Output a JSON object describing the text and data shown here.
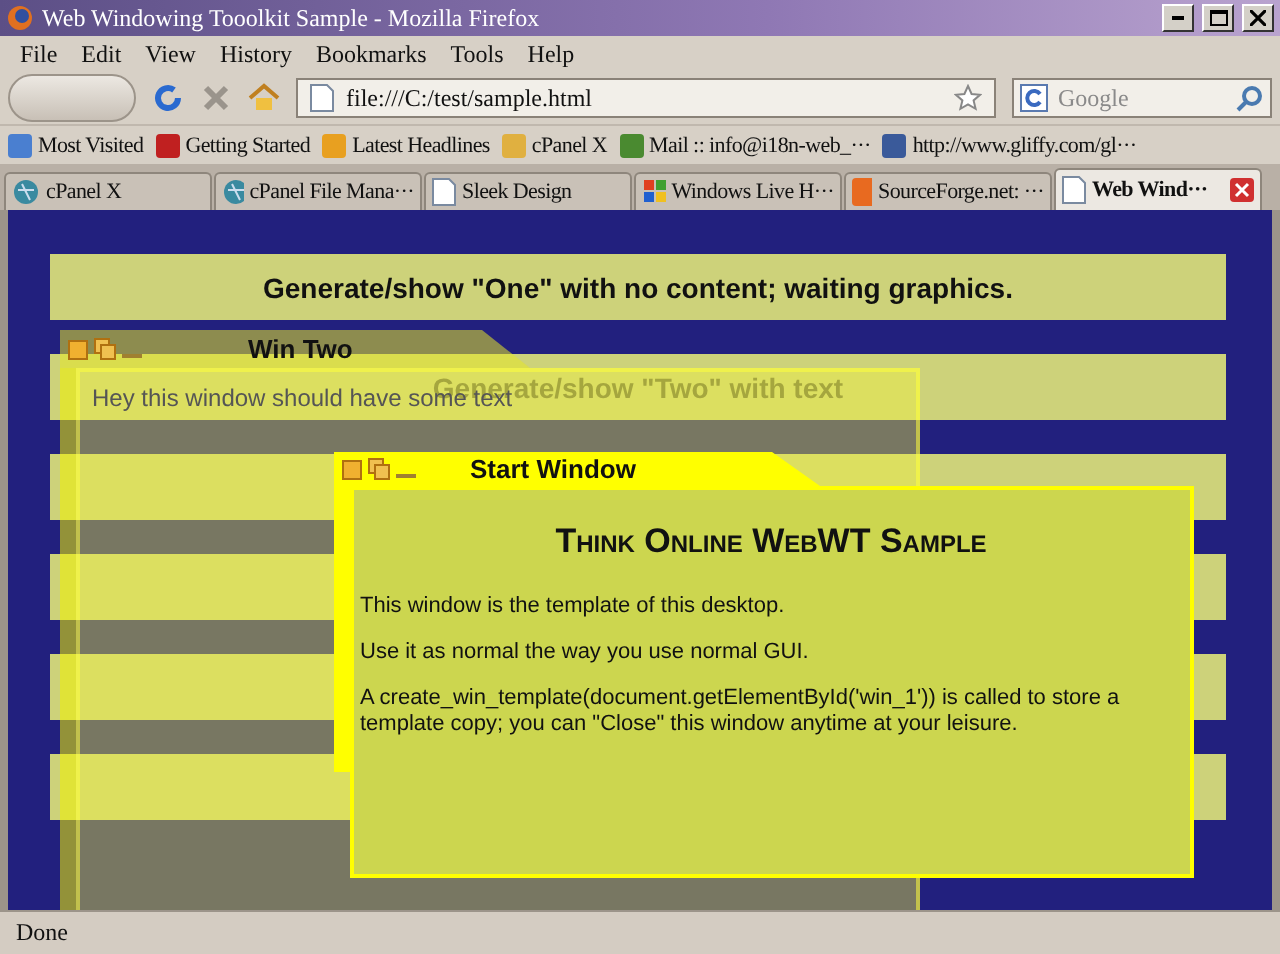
{
  "window": {
    "title": "Web Windowing Tooolkit Sample - Mozilla Firefox"
  },
  "menu": [
    "File",
    "Edit",
    "View",
    "History",
    "Bookmarks",
    "Tools",
    "Help"
  ],
  "address": {
    "value": "file:///C:/test/sample.html"
  },
  "search": {
    "placeholder": "Google"
  },
  "bookmarks": [
    {
      "label": "Most Visited",
      "color": "#4a7fd0"
    },
    {
      "label": "Getting Started",
      "color": "#c02020"
    },
    {
      "label": "Latest Headlines",
      "color": "#e8a020"
    },
    {
      "label": "cPanel X",
      "color": "#e0b040"
    },
    {
      "label": "Mail :: info@i18n-web_···",
      "color": "#4a8a30"
    },
    {
      "label": "http://www.gliffy.com/gl···",
      "color": "#3a5a9a"
    }
  ],
  "tabs": [
    {
      "label": "cPanel X",
      "selected": false,
      "kind": "globe"
    },
    {
      "label": "cPanel File Mana···",
      "selected": false,
      "kind": "globe"
    },
    {
      "label": "Sleek Design",
      "selected": false,
      "kind": "page"
    },
    {
      "label": "Windows Live H···",
      "selected": false,
      "kind": "flag"
    },
    {
      "label": "SourceForge.net: ···",
      "selected": false,
      "kind": "sf"
    },
    {
      "label": "Web Wind···",
      "selected": true,
      "kind": "page"
    }
  ],
  "page": {
    "bars": [
      {
        "kind": "text",
        "label": "Generate/show \"One\" with no content; waiting graphics."
      },
      {
        "kind": "text",
        "label": "Generate/show \"Two\" with text"
      },
      {
        "kind": "blank"
      },
      {
        "kind": "blank"
      },
      {
        "kind": "blank"
      },
      {
        "kind": "blank"
      }
    ],
    "win_two": {
      "title": "Win Two",
      "text": "Hey this window should have some text"
    },
    "start_window": {
      "title": "Start Window",
      "heading": "Think Online WebWT Sample",
      "paragraphs": [
        "This window is the template of this desktop.",
        "Use it as normal the way you use normal GUI.",
        "A create_win_template(document.getElementById('win_1')) is called to store a template copy; you can \"Close\" this window anytime at your leisure."
      ]
    }
  },
  "status_bar": "Done"
}
